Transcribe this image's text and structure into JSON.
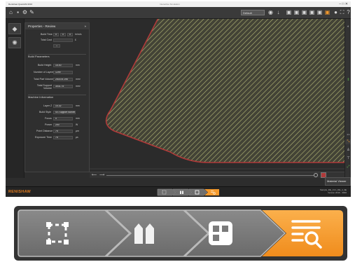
{
  "titlebar": {
    "app_title": "Renishaw QuantAM 2016",
    "document_title": "Interactive Simulation",
    "window_buttons": "–  □  ✕"
  },
  "toolbar": {
    "view_select": "Default",
    "help_label": "?"
  },
  "panel": {
    "title": "Properties - Review",
    "close": "»",
    "build_time": {
      "label": "Build Time",
      "hours": "0",
      "minutes": "0",
      "seconds": "0",
      "unit": "hr/m/s"
    },
    "total_cost": {
      "label": "Total Cost",
      "value": "",
      "unit": "£"
    },
    "section_build": "Build Parameters",
    "build_height": {
      "label": "Build Height",
      "value": "15.00",
      "unit": "mm"
    },
    "num_layers": {
      "label": "Number of Layers",
      "value": "1299",
      "unit": ""
    },
    "part_volume": {
      "label": "Total Part Volume",
      "value": "250378.196",
      "unit": "mm³"
    },
    "support_volume": {
      "label": "Total Support Volume",
      "value": "3031.75",
      "unit": "mm³"
    },
    "section_machine": "Machine Information",
    "layer": {
      "label": "Layer Z",
      "value": "14.32",
      "unit": "mm"
    },
    "build_style": {
      "label": "Build Style",
      "value": "SS Support Border",
      "unit": ""
    },
    "focus": {
      "label": "Focus",
      "value": "0",
      "unit": "mm"
    },
    "power": {
      "label": "Power",
      "value": "200",
      "unit": "W"
    },
    "point_distance": {
      "label": "Point Distance",
      "value": "75",
      "unit": "μm"
    },
    "exposure_time": {
      "label": "Exposure Time",
      "value": "75",
      "unit": "μs"
    }
  },
  "statusbar": {
    "logo": "RENISHAW",
    "file_name": "Sample_DE_13.1_DE_4_3E",
    "file_status": "Version 2016 - 3000",
    "material_viewer": "Material Viewer"
  },
  "workflow_tabs": [
    {
      "name": "Prepare",
      "icon": "prepare-icon",
      "active": false
    },
    {
      "name": "Supports",
      "icon": "supports-icon",
      "active": false
    },
    {
      "name": "Layout",
      "icon": "layout-icon",
      "active": false
    },
    {
      "name": "Review",
      "icon": "review-icon",
      "active": true
    }
  ],
  "colors": {
    "accent": "#f59a2c",
    "tab_gray": "#7a7a7a",
    "slice_border": "#b03a3a",
    "hatch": "#b5b878"
  }
}
